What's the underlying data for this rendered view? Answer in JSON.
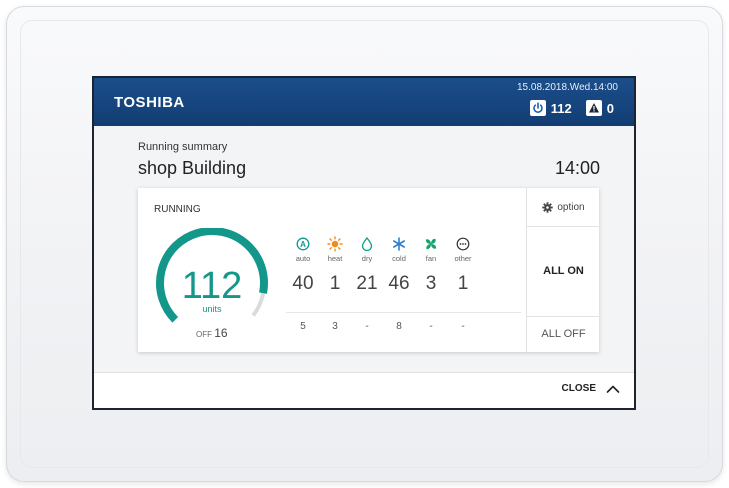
{
  "header": {
    "brand": "TOSHIBA",
    "datetime": "15.08.2018.Wed.14:00",
    "power_count": "112",
    "warning_count": "0"
  },
  "summary": {
    "subtitle": "Running summary",
    "building": "shop Building",
    "time": "14:00"
  },
  "card": {
    "running_label": "RUNNING",
    "total_units": "112",
    "units_label": "units",
    "off_label": "OFF",
    "off_count": "16",
    "gauge_running_fraction": 0.875,
    "modes": [
      {
        "label": "auto",
        "icon": "auto-mode-icon",
        "count": "40",
        "off": "5"
      },
      {
        "label": "heat",
        "icon": "sun-icon",
        "count": "1",
        "off": "3"
      },
      {
        "label": "dry",
        "icon": "water-drop-icon",
        "count": "21",
        "off": "-"
      },
      {
        "label": "cold",
        "icon": "snowflake-icon",
        "count": "46",
        "off": "8"
      },
      {
        "label": "fan",
        "icon": "fan-icon",
        "count": "3",
        "off": "-"
      },
      {
        "label": "other",
        "icon": "more-icon",
        "count": "1",
        "off": "-"
      }
    ],
    "option_label": "option",
    "all_on_label": "ALL ON",
    "all_off_label": "ALL OFF"
  },
  "footer": {
    "close_label": "CLOSE"
  },
  "colors": {
    "header_blue": "#174781",
    "gauge_teal": "#12978a",
    "gauge_grey": "#d9dcdf",
    "sun_orange": "#f28c1e",
    "icon_teal": "#0f9a8c",
    "snow_blue": "#2f7fd1",
    "fan_green": "#14a36b"
  }
}
